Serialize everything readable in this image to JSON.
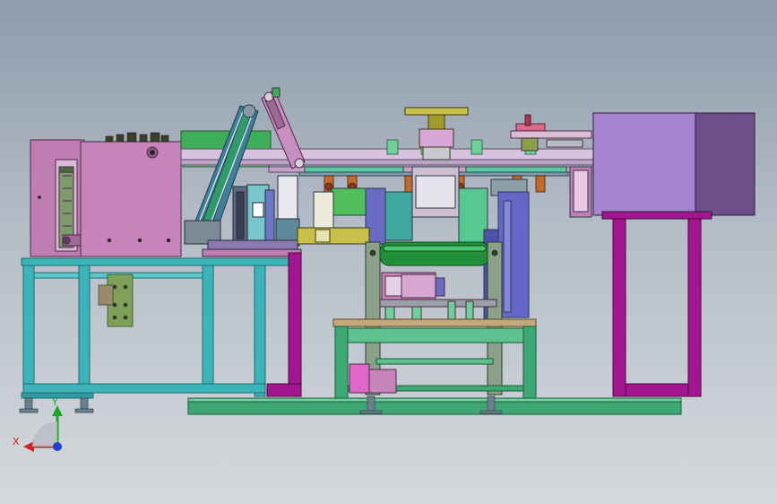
{
  "triad": {
    "x_label": "X",
    "y_label": "Y",
    "x_color": "#d42020",
    "y_color": "#1ea62a",
    "z_color": "#2440d0"
  },
  "colors": {
    "frame_cyan": "#3bb3b8",
    "frame_magenta": "#a3168f",
    "housing_pink": "#c87cb8",
    "housing_lavender": "#a684cf",
    "base_green": "#3ea873",
    "roller_green": "#1f8f3a",
    "plate_tan": "#c3a87a",
    "stand_blue": "#6466c8"
  }
}
